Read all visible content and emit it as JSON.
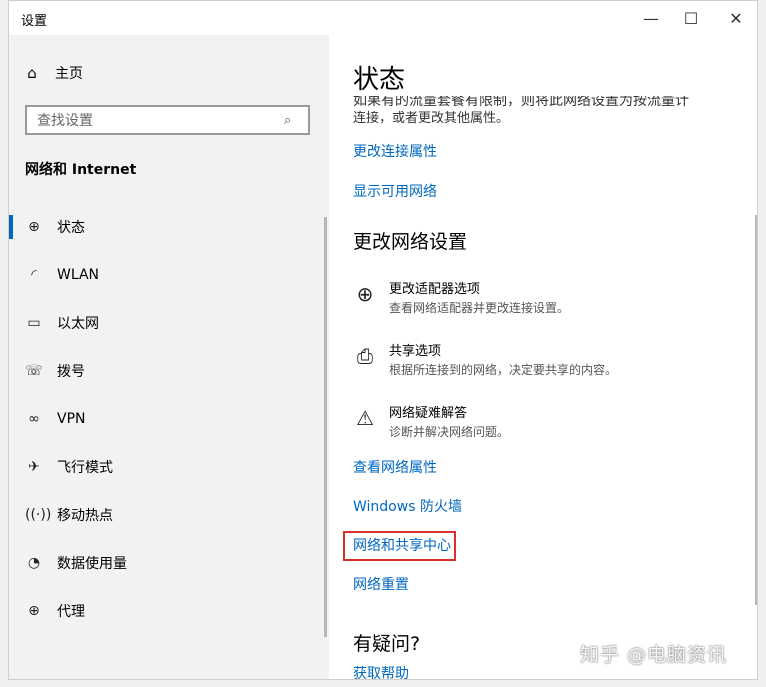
{
  "window": {
    "title": "设置",
    "minimize_glyph": "—",
    "maximize_glyph": "☐",
    "close_glyph": "✕"
  },
  "sidebar": {
    "home_label": "主页",
    "search_placeholder": "查找设置",
    "section_title": "网络和 Internet",
    "items": [
      {
        "label": "状态",
        "icon": "globe-icon"
      },
      {
        "label": "WLAN",
        "icon": "wifi-icon"
      },
      {
        "label": "以太网",
        "icon": "ethernet-icon"
      },
      {
        "label": "拨号",
        "icon": "dialup-icon"
      },
      {
        "label": "VPN",
        "icon": "vpn-icon"
      },
      {
        "label": "飞行模式",
        "icon": "airplane-icon"
      },
      {
        "label": "移动热点",
        "icon": "hotspot-icon"
      },
      {
        "label": "数据使用量",
        "icon": "data-usage-icon"
      },
      {
        "label": "代理",
        "icon": "globe-icon"
      }
    ]
  },
  "main": {
    "title": "状态",
    "partial_text": "如果有的流量套餐有限制，则将此网络设置为按流量计",
    "partial_text2": "连接，或者更改其他属性。",
    "link_change_connection": "更改连接属性",
    "link_show_networks": "显示可用网络",
    "section_heading": "更改网络设置",
    "settings": [
      {
        "title": "更改适配器选项",
        "desc": "查看网络适配器并更改连接设置。",
        "icon": "adapter-icon"
      },
      {
        "title": "共享选项",
        "desc": "根据所连接到的网络，决定要共享的内容。",
        "icon": "sharing-icon"
      },
      {
        "title": "网络疑难解答",
        "desc": "诊断并解决网络问题。",
        "icon": "warning-icon"
      }
    ],
    "link_view_properties": "查看网络属性",
    "link_firewall": "Windows 防火墙",
    "link_sharing_center": "网络和共享中心",
    "link_reset": "网络重置",
    "question_heading": "有疑问?",
    "link_help": "获取帮助"
  },
  "watermark": "知乎 @电脑资讯",
  "colors": {
    "accent": "#0067c0",
    "highlight_border": "#d9302e",
    "sidebar_bg": "#f2f2f2"
  }
}
